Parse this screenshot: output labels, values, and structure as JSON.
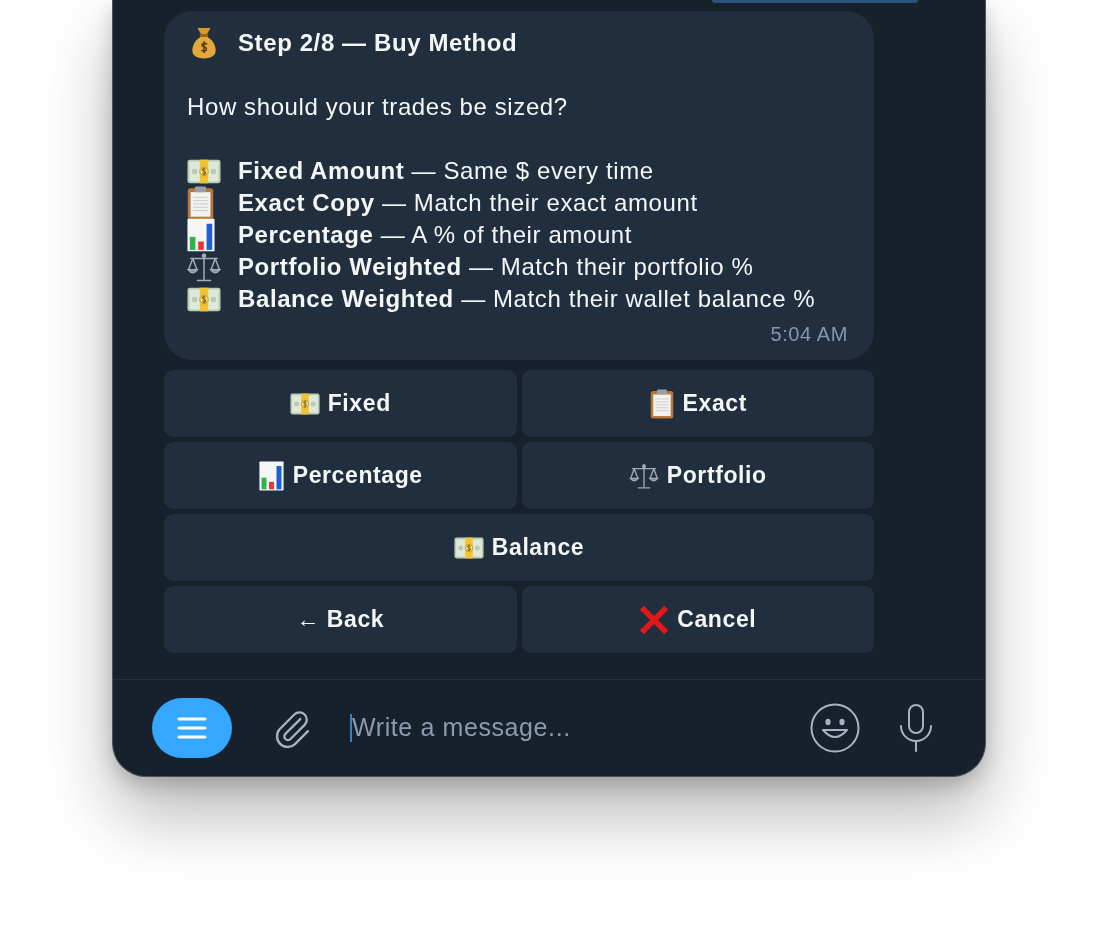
{
  "message": {
    "title": "Step 2/8 — Buy Method",
    "question": "How should your trades be sized?",
    "options": [
      {
        "kind": "fixed",
        "text": "**Fixed Amount** — Same $ every time"
      },
      {
        "kind": "exact",
        "text": "**Exact Copy** — Match their exact amount"
      },
      {
        "kind": "percentage",
        "text": "**Percentage** — A % of their amount"
      },
      {
        "kind": "portfolio",
        "text": "**Portfolio Weighted** — Match their portfolio %"
      },
      {
        "kind": "balance",
        "text": "**Balance Weighted** — Match their wallet balance %"
      }
    ],
    "time": "5:04 AM"
  },
  "keyboard": {
    "rows": [
      [
        {
          "kind": "fixed",
          "label": "Fixed"
        },
        {
          "kind": "exact",
          "label": "Exact"
        }
      ],
      [
        {
          "kind": "percentage",
          "label": "Percentage"
        },
        {
          "kind": "portfolio",
          "label": "Portfolio"
        }
      ],
      [
        {
          "kind": "balance",
          "label": "Balance"
        }
      ],
      [
        {
          "kind": "back",
          "label": "← Back"
        },
        {
          "kind": "cancel",
          "label": "Cancel"
        }
      ]
    ]
  },
  "composer": {
    "placeholder": "Write a message..."
  }
}
